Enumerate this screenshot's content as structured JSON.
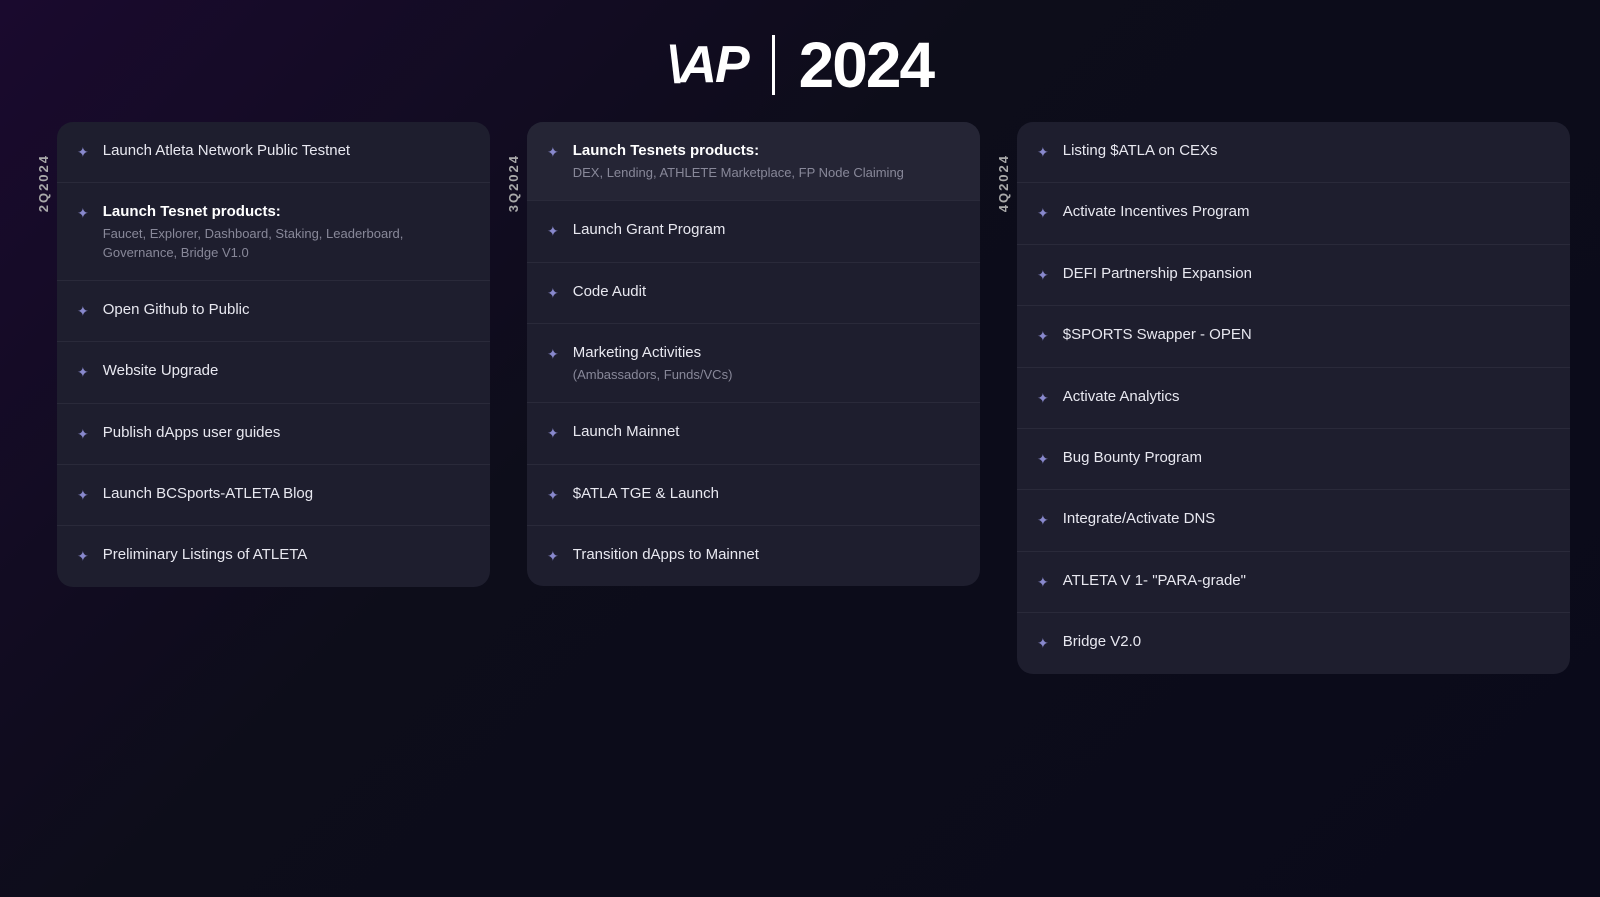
{
  "header": {
    "logo": "\\AP",
    "year": "2024"
  },
  "quarters": {
    "q2": {
      "label": "2Q2024",
      "items": [
        {
          "id": "q2-1",
          "title": "Launch Atleta Network Public Testnet",
          "subtitle": "",
          "bold": false
        },
        {
          "id": "q2-2",
          "title": "Launch Tesnet products:",
          "subtitle": "Faucet, Explorer, Dashboard, Staking, Leaderboard, Governance, Bridge V1.0",
          "bold": true
        },
        {
          "id": "q2-3",
          "title": "Open Github to Public",
          "subtitle": "",
          "bold": false
        },
        {
          "id": "q2-4",
          "title": "Website Upgrade",
          "subtitle": "",
          "bold": false
        },
        {
          "id": "q2-5",
          "title": "Publish dApps user guides",
          "subtitle": "",
          "bold": false
        },
        {
          "id": "q2-6",
          "title": "Launch BCSports-ATLETA Blog",
          "subtitle": "",
          "bold": false
        },
        {
          "id": "q2-7",
          "title": "Preliminary Listings of ATLETA",
          "subtitle": "",
          "bold": false
        }
      ]
    },
    "q3": {
      "label": "3Q2024",
      "items": [
        {
          "id": "q3-1",
          "title": "Launch Tesnets products:",
          "subtitle": "DEX, Lending, ATHLETE Marketplace, FP Node Claiming",
          "bold": true,
          "active": true
        },
        {
          "id": "q3-2",
          "title": "Launch Grant Program",
          "subtitle": "",
          "bold": false
        },
        {
          "id": "q3-3",
          "title": "Code Audit",
          "subtitle": "",
          "bold": false
        },
        {
          "id": "q3-4",
          "title": "Marketing Activities",
          "subtitle": "(Ambassadors, Funds/VCs)",
          "bold": false
        },
        {
          "id": "q3-5",
          "title": "Launch Mainnet",
          "subtitle": "",
          "bold": false
        },
        {
          "id": "q3-6",
          "title": "$ATLA TGE & Launch",
          "subtitle": "",
          "bold": false
        },
        {
          "id": "q3-7",
          "title": "Transition dApps to Mainnet",
          "subtitle": "",
          "bold": false
        }
      ]
    },
    "q4": {
      "label": "4Q2024",
      "items": [
        {
          "id": "q4-1",
          "title": "Listing $ATLA on CEXs",
          "subtitle": "",
          "bold": false
        },
        {
          "id": "q4-2",
          "title": "Activate Incentives Program",
          "subtitle": "",
          "bold": false
        },
        {
          "id": "q4-3",
          "title": "DEFI Partnership Expansion",
          "subtitle": "",
          "bold": false
        },
        {
          "id": "q4-4",
          "title": "$SPORTS Swapper - OPEN",
          "subtitle": "",
          "bold": false
        },
        {
          "id": "q4-5",
          "title": "Activate Analytics",
          "subtitle": "",
          "bold": false
        },
        {
          "id": "q4-6",
          "title": "Bug Bounty Program",
          "subtitle": "",
          "bold": false
        },
        {
          "id": "q4-7",
          "title": "Integrate/Activate DNS",
          "subtitle": "",
          "bold": false
        },
        {
          "id": "q4-8",
          "title": "ATLETA V 1- \"PARA-grade\"",
          "subtitle": "",
          "bold": false
        },
        {
          "id": "q4-9",
          "title": "Bridge V2.0",
          "subtitle": "",
          "bold": false
        }
      ]
    }
  },
  "icon": "✦"
}
